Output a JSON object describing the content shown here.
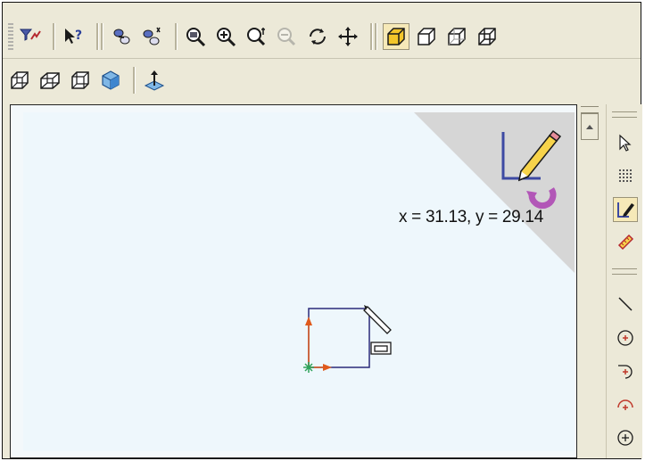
{
  "top_toolbar": {
    "row1": [
      {
        "name": "filter-icon",
        "pressed": false
      },
      {
        "name": "whats-this-help-icon",
        "pressed": false
      },
      {
        "name": "select-icon",
        "pressed": false
      },
      {
        "name": "select-other-icon",
        "pressed": false
      },
      {
        "name": "zoom-to-fit-icon",
        "pressed": false
      },
      {
        "name": "zoom-in-out-icon",
        "pressed": false
      },
      {
        "name": "zoom-to-area-icon",
        "pressed": false
      },
      {
        "name": "zoom-to-selection-icon",
        "pressed": false,
        "disabled": true
      },
      {
        "name": "rotate-view-icon",
        "pressed": false
      },
      {
        "name": "pan-icon",
        "pressed": false
      },
      {
        "name": "shaded-view-icon",
        "pressed": true
      },
      {
        "name": "wireframe-view-icon",
        "pressed": false
      },
      {
        "name": "hidden-lines-gray-icon",
        "pressed": false
      },
      {
        "name": "hidden-lines-removed-icon",
        "pressed": false
      }
    ],
    "row2": [
      {
        "name": "isometric-view-icon"
      },
      {
        "name": "trimetric-view-icon"
      },
      {
        "name": "dimetric-view-icon"
      },
      {
        "name": "shaded-cube-icon"
      },
      {
        "name": "normal-to-icon"
      }
    ]
  },
  "graphics_area": {
    "confirmation_corner_icon": "sketch-exit-icon",
    "cursor_coordinates": "x = 31.13, y = 29.14",
    "colors": {
      "background": "#eef7fc",
      "corner": "#d6d6d6",
      "sketch_line": "#2a2a7a",
      "x_axis": "#e05a1c",
      "y_axis": "#e05a1c",
      "origin": "#2ea35a"
    }
  },
  "right_toolbar": {
    "items": [
      {
        "name": "select-arrow-icon",
        "pressed": false
      },
      {
        "name": "grid-icon",
        "pressed": false
      },
      {
        "name": "sketch-icon",
        "pressed": true
      },
      {
        "name": "smart-dimension-icon",
        "pressed": false
      },
      {
        "name": "line-icon",
        "pressed": false
      },
      {
        "name": "circle-icon",
        "pressed": false
      },
      {
        "name": "tangent-arc-icon",
        "pressed": false
      },
      {
        "name": "centerpoint-arc-icon",
        "pressed": false
      },
      {
        "name": "point-circle-icon",
        "pressed": false
      }
    ]
  }
}
